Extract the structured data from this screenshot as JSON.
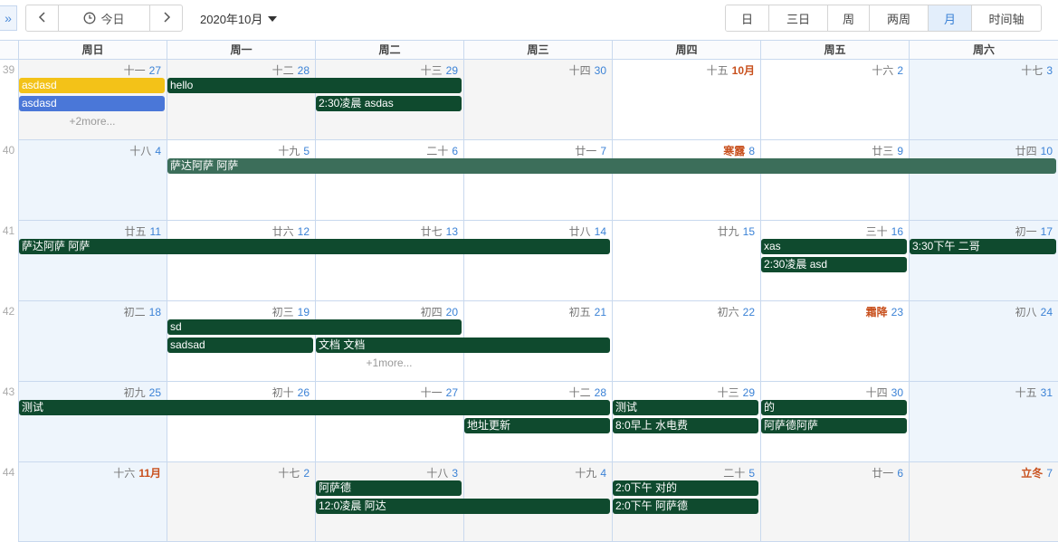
{
  "toolbar": {
    "expand_glyph": "»",
    "prev_glyph": "‹",
    "next_glyph": "›",
    "today_label": "今日",
    "month_label": "2020年10月",
    "views": [
      {
        "label": "日"
      },
      {
        "label": "三日"
      },
      {
        "label": "周"
      },
      {
        "label": "两周"
      },
      {
        "label": "月",
        "active": true
      },
      {
        "label": "时间轴"
      }
    ]
  },
  "weekdays": [
    "周日",
    "周一",
    "周二",
    "周三",
    "周四",
    "周五",
    "周六"
  ],
  "colors": {
    "accent": "#3b82d6",
    "term": "#c8501d",
    "event_default": "#0f4a2e",
    "event_yellow": "#f3c218",
    "event_blue": "#4a77d8",
    "event_teal": "#3c6e5a"
  },
  "weeks": [
    {
      "num": "39",
      "days": [
        {
          "lunar": "十一",
          "day": "27"
        },
        {
          "lunar": "十二",
          "day": "28"
        },
        {
          "lunar": "十三",
          "day": "29"
        },
        {
          "lunar": "十四",
          "day": "30"
        },
        {
          "lunar": "十五",
          "day": "10月",
          "month_start": true
        },
        {
          "lunar": "十六",
          "day": "2"
        },
        {
          "lunar": "十七",
          "day": "3"
        }
      ]
    },
    {
      "num": "40",
      "days": [
        {
          "lunar": "十八",
          "day": "4"
        },
        {
          "lunar": "十九",
          "day": "5"
        },
        {
          "lunar": "二十",
          "day": "6"
        },
        {
          "lunar": "廿一",
          "day": "7"
        },
        {
          "lunar": "寒露",
          "day": "8",
          "term": true
        },
        {
          "lunar": "廿三",
          "day": "9"
        },
        {
          "lunar": "廿四",
          "day": "10"
        }
      ]
    },
    {
      "num": "41",
      "days": [
        {
          "lunar": "廿五",
          "day": "11"
        },
        {
          "lunar": "廿六",
          "day": "12"
        },
        {
          "lunar": "廿七",
          "day": "13"
        },
        {
          "lunar": "廿八",
          "day": "14"
        },
        {
          "lunar": "廿九",
          "day": "15"
        },
        {
          "lunar": "三十",
          "day": "16"
        },
        {
          "lunar": "初一",
          "day": "17"
        }
      ]
    },
    {
      "num": "42",
      "days": [
        {
          "lunar": "初二",
          "day": "18"
        },
        {
          "lunar": "初三",
          "day": "19"
        },
        {
          "lunar": "初四",
          "day": "20"
        },
        {
          "lunar": "初五",
          "day": "21"
        },
        {
          "lunar": "初六",
          "day": "22"
        },
        {
          "lunar": "霜降",
          "day": "23",
          "term": true
        },
        {
          "lunar": "初八",
          "day": "24"
        }
      ]
    },
    {
      "num": "43",
      "days": [
        {
          "lunar": "初九",
          "day": "25"
        },
        {
          "lunar": "初十",
          "day": "26"
        },
        {
          "lunar": "十一",
          "day": "27"
        },
        {
          "lunar": "十二",
          "day": "28"
        },
        {
          "lunar": "十三",
          "day": "29"
        },
        {
          "lunar": "十四",
          "day": "30"
        },
        {
          "lunar": "十五",
          "day": "31"
        }
      ]
    },
    {
      "num": "44",
      "days": [
        {
          "lunar": "十六",
          "day": "11月",
          "month_start": true
        },
        {
          "lunar": "十七",
          "day": "2"
        },
        {
          "lunar": "十八",
          "day": "3"
        },
        {
          "lunar": "十九",
          "day": "4"
        },
        {
          "lunar": "二十",
          "day": "5"
        },
        {
          "lunar": "廿一",
          "day": "6"
        },
        {
          "lunar": "立冬",
          "day": "7",
          "term": true
        }
      ]
    }
  ],
  "events": [
    {
      "week": 0,
      "start": 0,
      "span": 1,
      "slot": 0,
      "title": "asdasd",
      "color": "event_yellow"
    },
    {
      "week": 0,
      "start": 0,
      "span": 1,
      "slot": 1,
      "title": "asdasd",
      "color": "event_blue"
    },
    {
      "week": 0,
      "start": 1,
      "span": 2,
      "slot": 0,
      "title": "hello"
    },
    {
      "week": 0,
      "start": 2,
      "span": 1,
      "slot": 1,
      "title": "2:30凌晨 asdas"
    },
    {
      "week": 1,
      "start": 1,
      "span": 6,
      "slot": 0,
      "title": "萨达阿萨 阿萨",
      "color": "event_teal"
    },
    {
      "week": 2,
      "start": 0,
      "span": 4,
      "slot": 0,
      "title": "萨达阿萨 阿萨"
    },
    {
      "week": 2,
      "start": 5,
      "span": 1,
      "slot": 0,
      "title": "xas"
    },
    {
      "week": 2,
      "start": 5,
      "span": 1,
      "slot": 1,
      "title": "2:30凌晨 asd"
    },
    {
      "week": 2,
      "start": 6,
      "span": 1,
      "slot": 0,
      "title": "3:30下午 二哥"
    },
    {
      "week": 3,
      "start": 1,
      "span": 2,
      "slot": 0,
      "title": "sd"
    },
    {
      "week": 3,
      "start": 1,
      "span": 1,
      "slot": 1,
      "title": "sadsad"
    },
    {
      "week": 3,
      "start": 2,
      "span": 2,
      "slot": 1,
      "title": "文档 文档"
    },
    {
      "week": 4,
      "start": 0,
      "span": 4,
      "slot": 0,
      "title": "测试"
    },
    {
      "week": 4,
      "start": 3,
      "span": 1,
      "slot": 1,
      "title": "地址更新"
    },
    {
      "week": 4,
      "start": 4,
      "span": 1,
      "slot": 0,
      "title": "测试"
    },
    {
      "week": 4,
      "start": 4,
      "span": 1,
      "slot": 1,
      "title": "8:0早上 水电费"
    },
    {
      "week": 4,
      "start": 5,
      "span": 1,
      "slot": 0,
      "title": "的"
    },
    {
      "week": 4,
      "start": 5,
      "span": 1,
      "slot": 1,
      "title": "阿萨德阿萨"
    },
    {
      "week": 5,
      "start": 2,
      "span": 1,
      "slot": 0,
      "title": "阿萨德"
    },
    {
      "week": 5,
      "start": 2,
      "span": 2,
      "slot": 1,
      "title": "12:0凌晨 阿达"
    },
    {
      "week": 5,
      "start": 4,
      "span": 1,
      "slot": 0,
      "title": "2:0下午 对的"
    },
    {
      "week": 5,
      "start": 4,
      "span": 1,
      "slot": 1,
      "title": "2:0下午 阿萨德"
    }
  ],
  "more_links": [
    {
      "week": 0,
      "col": 0,
      "label": "+2more..."
    },
    {
      "week": 3,
      "col": 2,
      "label": "+1more..."
    }
  ]
}
